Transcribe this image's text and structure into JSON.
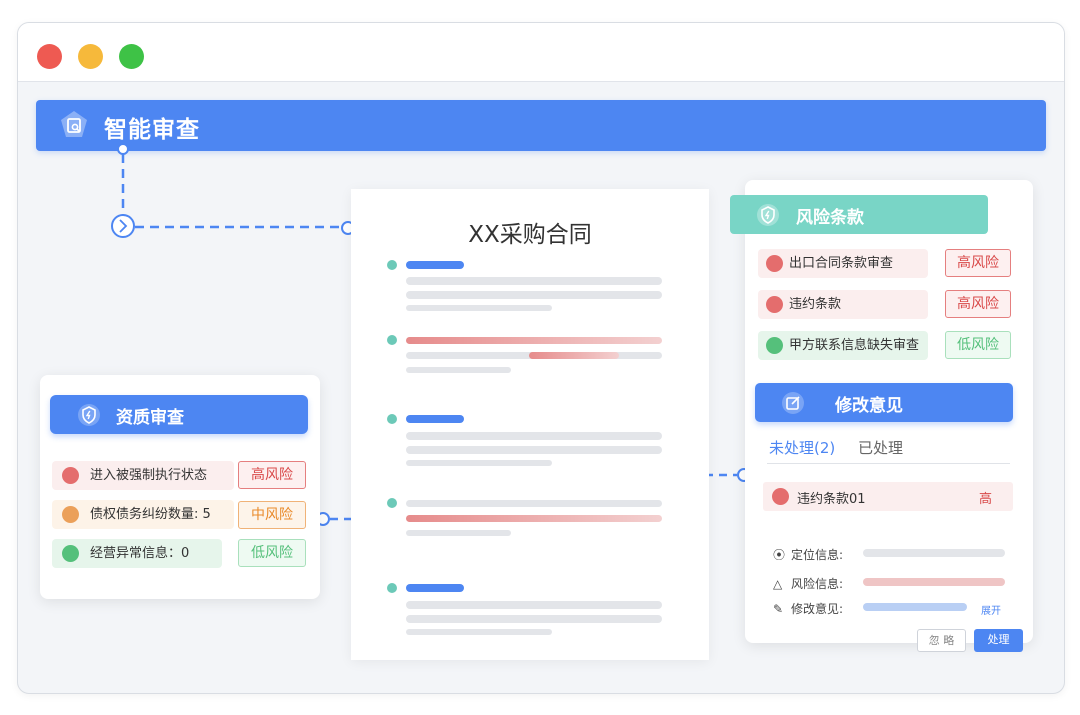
{
  "window": {
    "controls": [
      "close",
      "minimize",
      "maximize"
    ]
  },
  "header": {
    "title": "智能审查",
    "icon": "doc-search-icon"
  },
  "document": {
    "title": "XX采购合同"
  },
  "qualification": {
    "title": "资质审查",
    "items": [
      {
        "label": "进入被强制执行状态",
        "level": "高风险",
        "icon": "shield-icon",
        "color": "#e46d6d"
      },
      {
        "label": "债权债务纠纷数量: 5",
        "level": "中风险",
        "icon": "receipt-icon",
        "color": "#eba05a"
      },
      {
        "label": "经营异常信息：0",
        "level": "低风险",
        "icon": "doc-icon",
        "color": "#55c07b"
      }
    ]
  },
  "risk_clauses": {
    "title": "风险条款",
    "items": [
      {
        "label": "出口合同条款审查",
        "level": "高风险"
      },
      {
        "label": "违约条款",
        "level": "高风险"
      },
      {
        "label": "甲方联系信息缺失审查",
        "level": "低风险"
      }
    ]
  },
  "suggestions": {
    "title": "修改意见",
    "tabs": [
      "未处理(2)",
      "已处理"
    ],
    "issue": {
      "label": "违约条款01",
      "level": "高"
    },
    "details": [
      "定位信息:",
      "风险信息:",
      "修改意见:"
    ],
    "expand": "展开",
    "buttons": {
      "ignore": "忽 略",
      "handle": "处理"
    }
  },
  "colors": {
    "primary": "#4d86f2",
    "teal": "#79d5c6",
    "red": "#d94a4a",
    "orange": "#e98a2a",
    "green": "#55c07b"
  }
}
